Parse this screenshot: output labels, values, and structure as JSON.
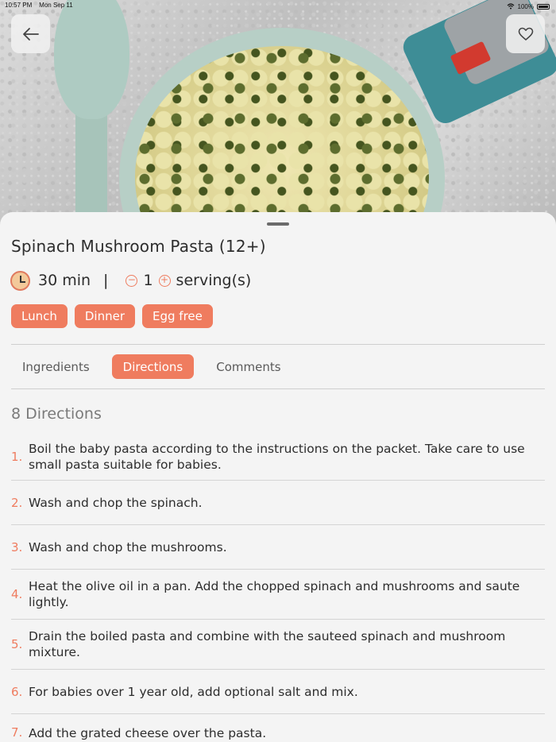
{
  "status_bar": {
    "time": "10:57 PM",
    "date": "Mon Sep 11",
    "battery": "100%"
  },
  "recipe": {
    "title": "Spinach Mushroom Pasta (12+)",
    "time": "30 min",
    "separator": "|",
    "servings": "1",
    "servings_label": "serving(s)",
    "decrement_symbol": "−",
    "increment_symbol": "+",
    "tags": [
      "Lunch",
      "Dinner",
      "Egg free"
    ]
  },
  "tabs": [
    "Ingredients",
    "Directions",
    "Comments"
  ],
  "active_tab": "Directions",
  "directions": {
    "heading": "8 Directions",
    "steps": [
      {
        "num": "1.",
        "text": "Boil the baby pasta according to the instructions on the packet. Take care to use small pasta suitable for babies."
      },
      {
        "num": "2.",
        "text": "Wash and chop the spinach."
      },
      {
        "num": "3.",
        "text": "Wash and chop the mushrooms."
      },
      {
        "num": "4.",
        "text": "Heat the olive oil in a pan. Add the chopped spinach and mushrooms and saute lightly."
      },
      {
        "num": "5.",
        "text": "Drain the boiled pasta and combine with the sauteed spinach and mushroom mixture."
      },
      {
        "num": "6.",
        "text": "For babies over 1 year old, add optional salt and mix."
      },
      {
        "num": "7.",
        "text": "Add the grated cheese over the pasta."
      }
    ]
  },
  "icons": {
    "back": "arrow-left-icon",
    "favorite": "heart-outline-icon",
    "time": "clock-icon",
    "wifi": "wifi-icon",
    "battery": "battery-icon"
  },
  "colors": {
    "accent": "#ef7c5f",
    "sheet": "#f4f4f4"
  }
}
